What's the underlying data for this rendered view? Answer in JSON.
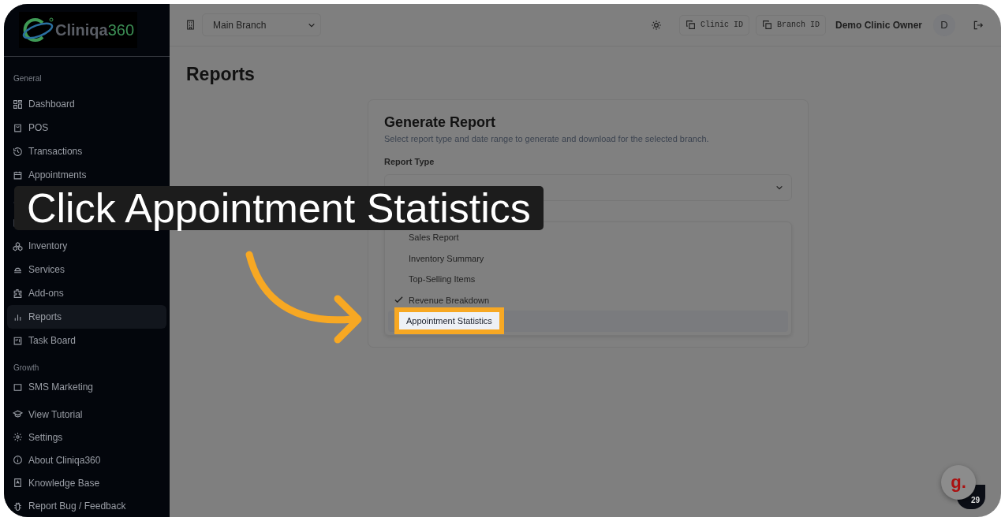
{
  "sidebar": {
    "logo": {
      "name": "Cliniqa",
      "suffix": "360"
    },
    "sections": [
      {
        "title": "General",
        "items": [
          {
            "label": "Dashboard",
            "selected": false
          },
          {
            "label": "POS",
            "selected": false
          },
          {
            "label": "Transactions",
            "selected": false
          },
          {
            "label": "Appointments",
            "selected": false
          },
          {
            "selected": false
          },
          {
            "selected": false
          },
          {
            "label": "Inventory",
            "selected": false
          },
          {
            "label": "Services",
            "selected": false
          },
          {
            "label": "Add-ons",
            "selected": false
          },
          {
            "label": "Reports",
            "selected": true
          },
          {
            "label": "Task Board",
            "selected": false
          }
        ]
      },
      {
        "title": "Growth",
        "items": [
          {
            "label": "SMS Marketing",
            "selected": false
          }
        ]
      }
    ],
    "footer_items": [
      "View Tutorial",
      "Settings",
      "About Cliniqa360",
      "Knowledge Base",
      "Report Bug / Feedback"
    ]
  },
  "topbar": {
    "branch_select": {
      "value": "Main Branch"
    },
    "buttons": [
      "Clinic ID",
      "Branch ID"
    ],
    "user_name": "Demo Clinic Owner",
    "avatar": "D"
  },
  "page": {
    "title": "Reports",
    "card": {
      "title": "Generate Report",
      "description": "Select report type and date range to generate and download for the selected branch.",
      "field_label": "Report Type",
      "options": [
        {
          "label": "Sales Report",
          "checked": false,
          "highlighted": false
        },
        {
          "label": "Inventory Summary",
          "checked": false,
          "highlighted": false
        },
        {
          "label": "Top-Selling Items",
          "checked": false,
          "highlighted": false
        },
        {
          "label": "Revenue Breakdown",
          "checked": true,
          "highlighted": false
        },
        {
          "label": "Appointment Statistics",
          "checked": false,
          "highlighted": true
        }
      ]
    }
  },
  "tutorial": {
    "caption": "Click Appointment Statistics"
  },
  "help_widget": {
    "logo": "g.",
    "count": "29"
  }
}
